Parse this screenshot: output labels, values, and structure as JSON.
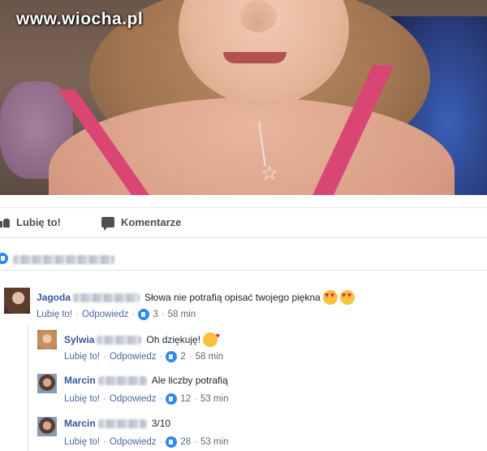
{
  "watermark": "www.wiocha.pl",
  "actions": {
    "like_label": "Lubię to!",
    "comment_label": "Komentarze"
  },
  "comments": [
    {
      "author": "Jagoda",
      "text": "Słowa nie potrafią opisać twojego piękna",
      "emoji": "heart-eyes",
      "like_label": "Lubię to!",
      "reply_label": "Odpowiedz",
      "likes": "3",
      "time": "58 min"
    },
    {
      "author": "Sylwia",
      "text": "Oh dziękuję!",
      "emoji": "kiss",
      "like_label": "Lubię to!",
      "reply_label": "Odpowiedz",
      "likes": "2",
      "time": "58 min"
    },
    {
      "author": "Marcin",
      "text": "Ale liczby potrafią",
      "like_label": "Lubię to!",
      "reply_label": "Odpowiedz",
      "likes": "12",
      "time": "53 min"
    },
    {
      "author": "Marcin",
      "text": "3/10",
      "like_label": "Lubię to!",
      "reply_label": "Odpowiedz",
      "likes": "28",
      "time": "53 min"
    }
  ],
  "colors": {
    "link": "#365899",
    "like_blue": "#2d88ff",
    "strap_pink": "#d94674"
  }
}
